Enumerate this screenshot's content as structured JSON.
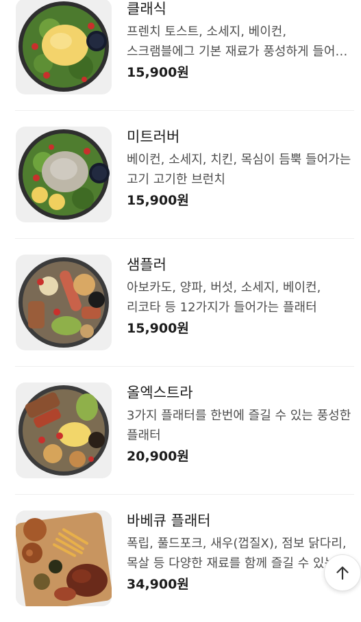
{
  "menu": {
    "items": [
      {
        "name": "클래식",
        "description": "프렌치 토스트, 소세지, 베이컨, 스크램블에그 기본 재료가 풍성하게 들어간 플래터",
        "price": "15,900원",
        "image": "salad-plate-scrambled-egg"
      },
      {
        "name": "미트러버",
        "description": "베이컨, 소세지, 치킨, 목심이 듬뿍 들어가는 고기 고기한 브런치",
        "price": "15,900원",
        "image": "salad-plate-meat-sauce"
      },
      {
        "name": "샘플러",
        "description": "아보카도, 양파, 버섯, 소세지, 베이컨, 리코타 등 12가지가 들어가는 플래터",
        "price": "15,900원",
        "image": "sampler-platter"
      },
      {
        "name": "올엑스트라",
        "description": "3가지 플래터를 한번에 즐길 수 있는 풍성한 플래터",
        "price": "20,900원",
        "image": "all-extra-platter"
      },
      {
        "name": "바베큐 플래터",
        "description": "폭립, 풀드포크, 새우(껍질X), 점보 닭다리, 목살 등 다양한 재료를 함께 즐길 수 있는 플래터",
        "price": "34,900원",
        "image": "bbq-wooden-board"
      }
    ]
  },
  "scroll_top": {
    "icon": "arrow-up-icon"
  }
}
